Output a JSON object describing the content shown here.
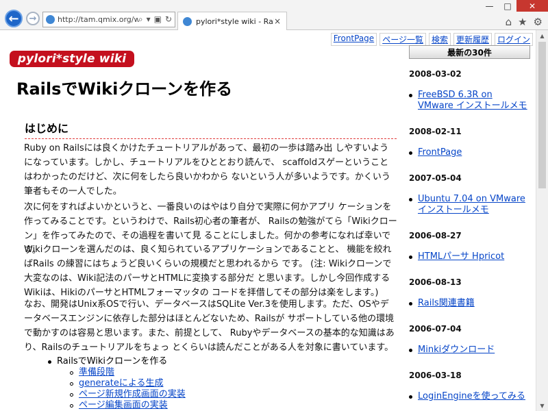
{
  "browser": {
    "address": "http://tam.qmix.org/wiki/",
    "tab_title": "pylori*style wiki - Rails..."
  },
  "top_nav": [
    "FrontPage",
    "ページ一覧",
    "検索",
    "更新履歴",
    "ログイン"
  ],
  "site": {
    "logo": "pylori*style wiki",
    "title": "RailsでWikiクローンを作る"
  },
  "article": {
    "section_title": "はじめに",
    "paragraphs": [
      "Ruby on Railsには良くかけたチュートリアルがあって、最初の一歩は踏み出 しやすいようになっています。しかし、チュートリアルをひととおり読んで、 scaffoldスゲーということはわかったのだけど、次に何をしたら良いかわから ないという人が多いようです。かくいう筆者もその一人でした。",
      "次に何をすればよいかというと、一番良いのはやはり自分で実際に何かアプリ ケーションを作ってみることです。というわけで、Rails初心者の筆者が、 Railsの勉強がてら「Wikiクローン」を作ってみたので、その過程を書いて見 ることにしました。何かの参考になれば幸いです。",
      "Wikiクローンを選んだのは、良く知られているアプリケーションであることと、 機能を絞ればRails の練習にはちょうど良いくらいの規模だと思われるから です。 (注: Wikiクローンで大変なのは、Wiki記法のパーサとHTMLに変換する部分だ と思います。しかし今回作成するWikiは、HikiのパーサとHTMLフォーマッタの コードを拝借してその部分は楽をします。)",
      "なお、開発はUnix系OSで行い、データベースはSQLite Ver.3を使用します。ただ、OSやデータベースエンジンに依存した部分はほとんどないため、Railsが サポートしている他の環境で動かすのは容易と思います。また、前提として、 Rubyやデータベースの基本的な知識はあり、Railsのチュートリアルをちょっ とくらいは読んだことがある人を対象に書いています。"
    ],
    "toc_main": "RailsでWikiクローンを作る",
    "toc_sub": [
      "準備段階",
      "generateによる生成",
      "ページ新規作成画面の実装",
      "ページ編集画面の実装"
    ]
  },
  "sidebar": {
    "recent_title": "最新の30件",
    "entries": [
      {
        "date": "2008-03-02",
        "link": "FreeBSD 6.3R on VMware インストールメモ"
      },
      {
        "date": "2008-02-11",
        "link": "FrontPage"
      },
      {
        "date": "2007-05-04",
        "link": "Ubuntu 7.04 on VMware インストールメモ"
      },
      {
        "date": "2006-08-27",
        "link": "HTMLパーサ Hpricot"
      },
      {
        "date": "2006-08-13",
        "link": "Rails関連書籍"
      },
      {
        "date": "2006-07-04",
        "link": "Minkiダウンロード"
      },
      {
        "date": "2006-03-18",
        "link": "LoginEngineを使ってみる"
      }
    ]
  },
  "icons": {
    "back": "back-icon",
    "forward": "forward-icon",
    "home": "home-icon",
    "favorites": "star-icon",
    "settings": "gear-icon"
  }
}
